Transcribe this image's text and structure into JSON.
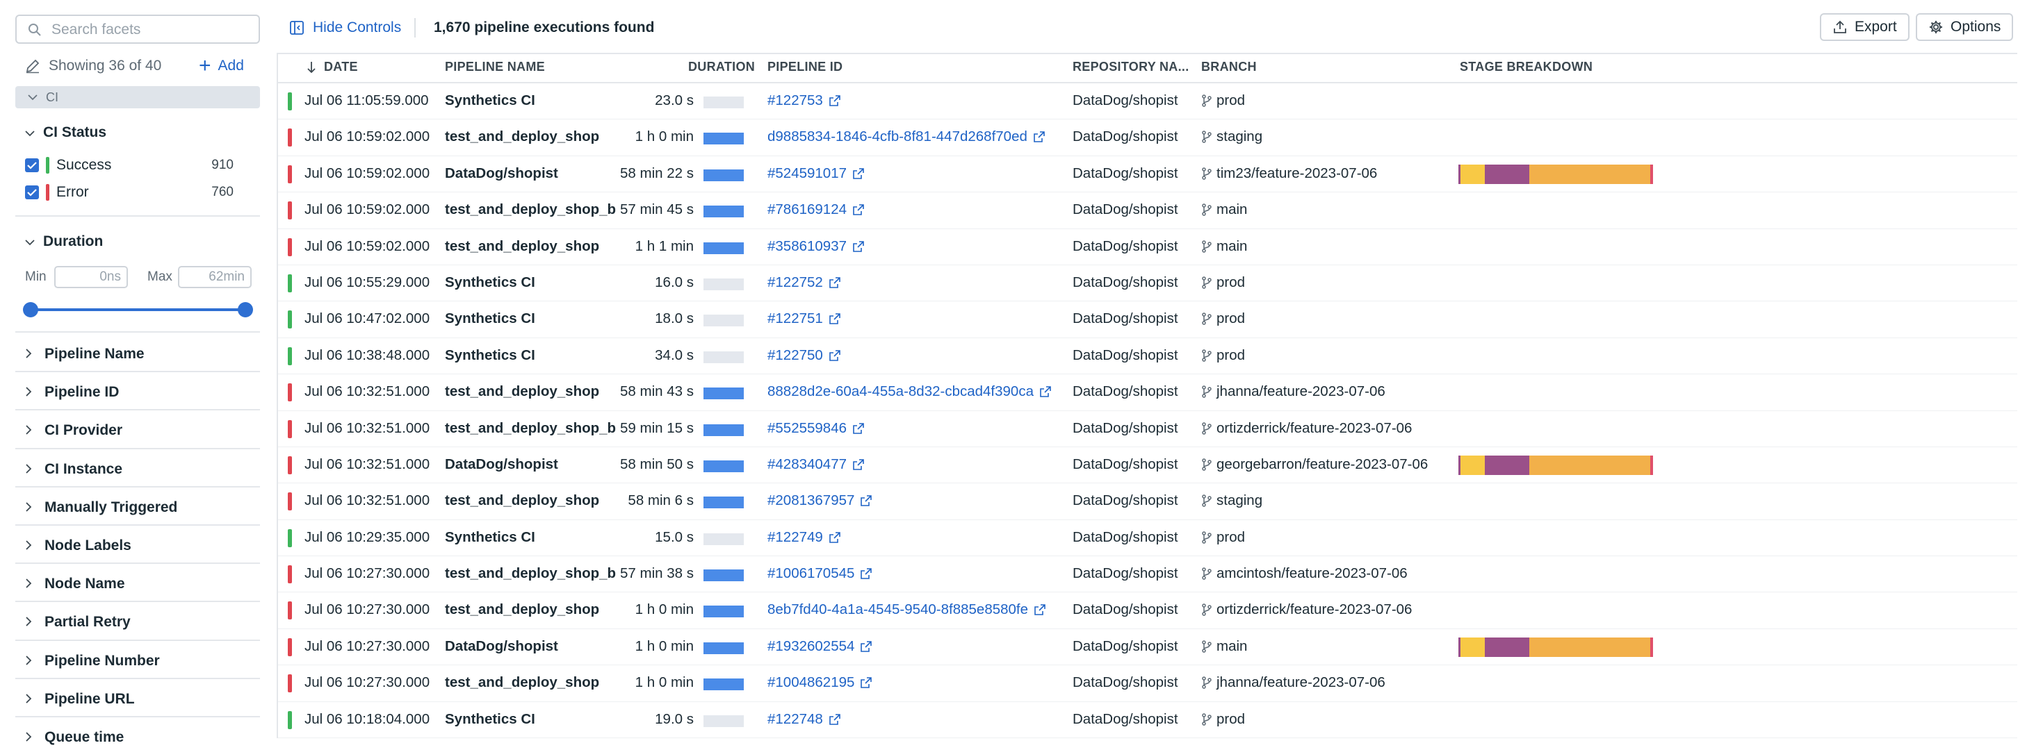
{
  "search": {
    "placeholder": "Search facets"
  },
  "facets_header": {
    "showing": "Showing 36 of 40",
    "add": "Add"
  },
  "ci_tag": "CI",
  "ci_status": {
    "title": "CI Status",
    "items": [
      {
        "label": "Success",
        "count": "910",
        "color": "#3eb55b"
      },
      {
        "label": "Error",
        "count": "760",
        "color": "#e0454f"
      }
    ]
  },
  "duration": {
    "title": "Duration",
    "min_label": "Min",
    "max_label": "Max",
    "min_placeholder": "0ns",
    "max_placeholder": "62min"
  },
  "collapsed_facets": [
    "Pipeline Name",
    "Pipeline ID",
    "CI Provider",
    "CI Instance",
    "Manually Triggered",
    "Node Labels",
    "Node Name",
    "Partial Retry",
    "Pipeline Number",
    "Pipeline URL",
    "Queue time"
  ],
  "toolbar": {
    "hide_controls": "Hide Controls",
    "found": "1,670 pipeline executions found",
    "export": "Export",
    "options": "Options"
  },
  "columns": {
    "date": "DATE",
    "pipeline_name": "PIPELINE NAME",
    "duration": "DURATION",
    "pipeline_id": "PIPELINE ID",
    "repository": "REPOSITORY NA...",
    "branch": "BRANCH",
    "stage": "STAGE BREAKDOWN"
  },
  "colors": {
    "success": "#3eb55b",
    "error": "#e0454f",
    "accent": "#1f63c6",
    "bar_full": "#4a8be8",
    "bar_empty": "#e4e8ee",
    "stage_yellow": "#f8c945",
    "stage_purple": "#9a5089",
    "stage_orange": "#f2b04a",
    "stage_red": "#e0506a"
  },
  "rows": [
    {
      "status": "success",
      "date": "Jul 06 11:05:59.000",
      "name": "Synthetics CI",
      "duration": "23.0 s",
      "bar": "empty",
      "id": "#122753",
      "repo": "DataDog/shopist",
      "branch": "prod",
      "stages": false
    },
    {
      "status": "error",
      "date": "Jul 06 10:59:02.000",
      "name": "test_and_deploy_shop",
      "duration": "1 h 0 min",
      "bar": "full",
      "id": "d9885834-1846-4cfb-8f81-447d268f70ed",
      "repo": "DataDog/shopist",
      "branch": "staging",
      "stages": false
    },
    {
      "status": "error",
      "date": "Jul 06 10:59:02.000",
      "name": "DataDog/shopist",
      "duration": "58 min 22 s",
      "bar": "full",
      "id": "#524591017",
      "repo": "DataDog/shopist",
      "branch": "tim23/feature-2023-07-06",
      "stages": true
    },
    {
      "status": "error",
      "date": "Jul 06 10:59:02.000",
      "name": "test_and_deploy_shop_b",
      "duration": "57 min 45 s",
      "bar": "full",
      "id": "#786169124",
      "repo": "DataDog/shopist",
      "branch": "main",
      "stages": false
    },
    {
      "status": "error",
      "date": "Jul 06 10:59:02.000",
      "name": "test_and_deploy_shop",
      "duration": "1 h 1 min",
      "bar": "full",
      "id": "#358610937",
      "repo": "DataDog/shopist",
      "branch": "main",
      "stages": false
    },
    {
      "status": "success",
      "date": "Jul 06 10:55:29.000",
      "name": "Synthetics CI",
      "duration": "16.0 s",
      "bar": "empty",
      "id": "#122752",
      "repo": "DataDog/shopist",
      "branch": "prod",
      "stages": false
    },
    {
      "status": "success",
      "date": "Jul 06 10:47:02.000",
      "name": "Synthetics CI",
      "duration": "18.0 s",
      "bar": "empty",
      "id": "#122751",
      "repo": "DataDog/shopist",
      "branch": "prod",
      "stages": false
    },
    {
      "status": "success",
      "date": "Jul 06 10:38:48.000",
      "name": "Synthetics CI",
      "duration": "34.0 s",
      "bar": "empty",
      "id": "#122750",
      "repo": "DataDog/shopist",
      "branch": "prod",
      "stages": false
    },
    {
      "status": "error",
      "date": "Jul 06 10:32:51.000",
      "name": "test_and_deploy_shop",
      "duration": "58 min 43 s",
      "bar": "full",
      "id": "88828d2e-60a4-455a-8d32-cbcad4f390ca",
      "repo": "DataDog/shopist",
      "branch": "jhanna/feature-2023-07-06",
      "stages": false
    },
    {
      "status": "error",
      "date": "Jul 06 10:32:51.000",
      "name": "test_and_deploy_shop_b",
      "duration": "59 min 15 s",
      "bar": "full",
      "id": "#552559846",
      "repo": "DataDog/shopist",
      "branch": "ortizderrick/feature-2023-07-06",
      "stages": false
    },
    {
      "status": "error",
      "date": "Jul 06 10:32:51.000",
      "name": "DataDog/shopist",
      "duration": "58 min 50 s",
      "bar": "full",
      "id": "#428340477",
      "repo": "DataDog/shopist",
      "branch": "georgebarron/feature-2023-07-06",
      "stages": true
    },
    {
      "status": "error",
      "date": "Jul 06 10:32:51.000",
      "name": "test_and_deploy_shop",
      "duration": "58 min 6 s",
      "bar": "full",
      "id": "#2081367957",
      "repo": "DataDog/shopist",
      "branch": "staging",
      "stages": false
    },
    {
      "status": "success",
      "date": "Jul 06 10:29:35.000",
      "name": "Synthetics CI",
      "duration": "15.0 s",
      "bar": "empty",
      "id": "#122749",
      "repo": "DataDog/shopist",
      "branch": "prod",
      "stages": false
    },
    {
      "status": "error",
      "date": "Jul 06 10:27:30.000",
      "name": "test_and_deploy_shop_b",
      "duration": "57 min 38 s",
      "bar": "full",
      "id": "#1006170545",
      "repo": "DataDog/shopist",
      "branch": "amcintosh/feature-2023-07-06",
      "stages": false
    },
    {
      "status": "error",
      "date": "Jul 06 10:27:30.000",
      "name": "test_and_deploy_shop",
      "duration": "1 h 0 min",
      "bar": "full",
      "id": "8eb7fd40-4a1a-4545-9540-8f885e8580fe",
      "repo": "DataDog/shopist",
      "branch": "ortizderrick/feature-2023-07-06",
      "stages": false
    },
    {
      "status": "error",
      "date": "Jul 06 10:27:30.000",
      "name": "DataDog/shopist",
      "duration": "1 h 0 min",
      "bar": "full",
      "id": "#1932602554",
      "repo": "DataDog/shopist",
      "branch": "main",
      "stages": true
    },
    {
      "status": "error",
      "date": "Jul 06 10:27:30.000",
      "name": "test_and_deploy_shop",
      "duration": "1 h 0 min",
      "bar": "full",
      "id": "#1004862195",
      "repo": "DataDog/shopist",
      "branch": "jhanna/feature-2023-07-06",
      "stages": false
    },
    {
      "status": "success",
      "date": "Jul 06 10:18:04.000",
      "name": "Synthetics CI",
      "duration": "19.0 s",
      "bar": "empty",
      "id": "#122748",
      "repo": "DataDog/shopist",
      "branch": "prod",
      "stages": false
    }
  ]
}
